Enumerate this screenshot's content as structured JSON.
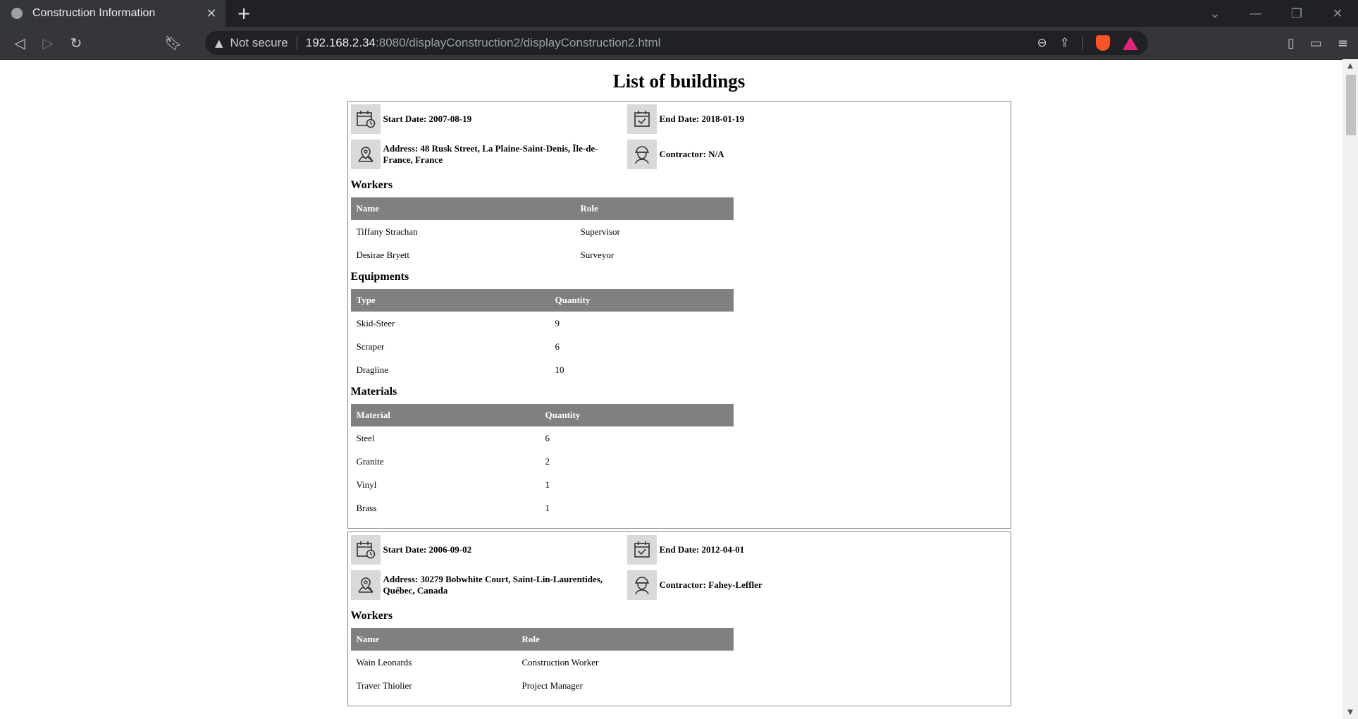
{
  "browser": {
    "tab_title": "Construction Information",
    "not_secure": "Not secure",
    "url_host": "192.168.2.34",
    "url_path": ":8080/displayConstruction2/displayConstruction2.html"
  },
  "page": {
    "title": "List of buildings",
    "buildings": [
      {
        "start": "Start Date: 2007-08-19",
        "end": "End Date: 2018-01-19",
        "address": "Address: 48 Rusk Street, La Plaine-Saint-Denis, Île-de-France, France",
        "contractor": "Contractor: N/A",
        "workers_title": "Workers",
        "workers_headers": [
          "Name",
          "Role"
        ],
        "workers": [
          [
            "Tiffany Strachan",
            "Supervisor"
          ],
          [
            "Desirae Bryett",
            "Surveyor"
          ]
        ],
        "equip_title": "Equipments",
        "equip_headers": [
          "Type",
          "Quantity"
        ],
        "equipments": [
          [
            "Skid-Steer",
            "9"
          ],
          [
            "Scraper",
            "6"
          ],
          [
            "Dragline",
            "10"
          ]
        ],
        "mat_title": "Materials",
        "mat_headers": [
          "Material",
          "Quantity"
        ],
        "materials": [
          [
            "Steel",
            "6"
          ],
          [
            "Granite",
            "2"
          ],
          [
            "Vinyl",
            "1"
          ],
          [
            "Brass",
            "1"
          ]
        ]
      },
      {
        "start": "Start Date: 2006-09-02",
        "end": "End Date: 2012-04-01",
        "address": "Address: 30279 Bobwhite Court, Saint-Lin-Laurentides, Québec, Canada",
        "contractor": "Contractor: Fahey-Leffler",
        "workers_title": "Workers",
        "workers_headers": [
          "Name",
          "Role"
        ],
        "workers": [
          [
            "Wain Leonards",
            "Construction Worker"
          ],
          [
            "Traver Thiolier",
            "Project Manager"
          ]
        ]
      }
    ]
  }
}
